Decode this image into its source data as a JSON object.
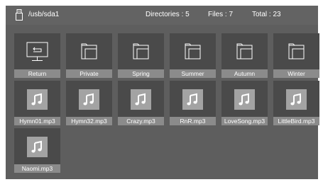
{
  "header": {
    "path": "/usb/sda1",
    "directories": "Directories : 5",
    "files": "Files : 7",
    "total": "Total : 23",
    "icon": "usb-drive-icon"
  },
  "items": [
    {
      "label": "Return",
      "icon": "monitor-return-icon"
    },
    {
      "label": "Private",
      "icon": "folder-icon"
    },
    {
      "label": "Spring",
      "icon": "folder-icon"
    },
    {
      "label": "Summer",
      "icon": "folder-icon"
    },
    {
      "label": "Autumn",
      "icon": "folder-icon"
    },
    {
      "label": "Winter",
      "icon": "folder-icon"
    },
    {
      "label": "Hymn01.mp3",
      "icon": "music-note-icon"
    },
    {
      "label": "Hymn32.mp3",
      "icon": "music-note-icon"
    },
    {
      "label": "Crazy.mp3",
      "icon": "music-note-icon"
    },
    {
      "label": "RnR.mp3",
      "icon": "music-note-icon"
    },
    {
      "label": "LoveSong.mp3",
      "icon": "music-note-icon"
    },
    {
      "label": "LittleBird.mp3",
      "icon": "music-note-icon"
    },
    {
      "label": "Naomi.mp3",
      "icon": "music-note-icon"
    }
  ],
  "colors": {
    "frame": "#5e5e5e",
    "tile": "#4a4a4a",
    "caption": "#8b8b8b",
    "text": "#ffffff"
  }
}
